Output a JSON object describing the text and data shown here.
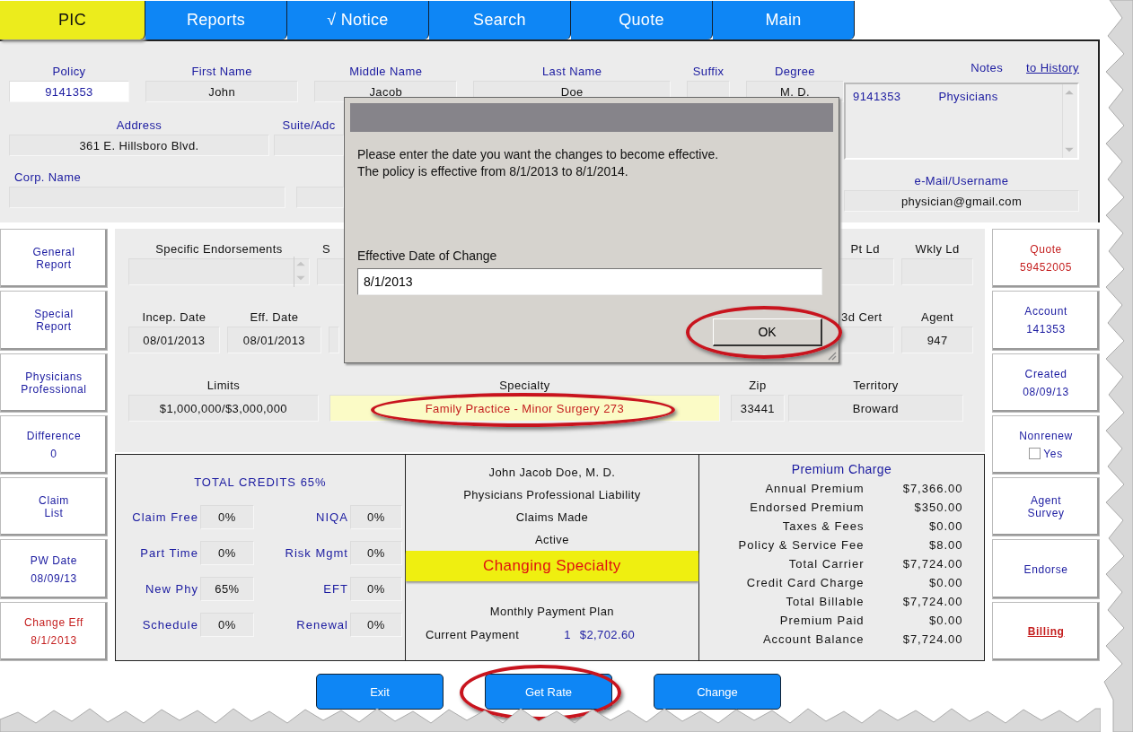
{
  "tabs": [
    {
      "label": "PIC",
      "selected": true
    },
    {
      "label": "Reports",
      "selected": false
    },
    {
      "label": "√ Notice",
      "selected": false
    },
    {
      "label": "Search",
      "selected": false
    },
    {
      "label": "Quote",
      "selected": false
    },
    {
      "label": "Main",
      "selected": false
    }
  ],
  "header": {
    "row1": [
      {
        "label": "Policy",
        "value": "9141353",
        "kind": "key"
      },
      {
        "label": "First Name",
        "value": "John",
        "kind": "plain"
      },
      {
        "label": "Middle Name",
        "value": "Jacob",
        "kind": "plain"
      },
      {
        "label": "Last Name",
        "value": "Doe",
        "kind": "plain"
      },
      {
        "label": "Suffix",
        "kind": "plain"
      },
      {
        "label": "Degree",
        "value": "M. D.",
        "kind": "plain"
      }
    ],
    "row2": [
      {
        "label": "Address",
        "value": "361 E. Hillsboro Blvd."
      },
      {
        "label": "Suite/Adc"
      }
    ],
    "corp": {
      "label": "Corp. Name"
    },
    "notes": {
      "label": "Notes",
      "link": "to History",
      "entries": [
        {
          "number": "9141353",
          "type": "Physicians"
        }
      ]
    },
    "email": {
      "label": "e-Mail/Username",
      "value": "physician@gmail.com"
    }
  },
  "dialog": {
    "message": [
      "Please enter the date you want the changes to become effective.",
      "The policy is effective from 8/1/2013 to 8/1/2014."
    ],
    "field_label": "Effective Date of Change",
    "field_value": "8/1/2013",
    "ok": {
      "label": "OK",
      "circled": true
    }
  },
  "left_buttons": [
    {
      "label": "General Report",
      "color": "#1a1aa0"
    },
    {
      "label": "Special Report",
      "color": "#1a1aa0"
    },
    {
      "label": "Physicians Professional",
      "color": "#1a1aa0"
    },
    {
      "label": "Difference",
      "value": "0",
      "color": "#1a1aa0"
    },
    {
      "label": "Claim List",
      "color": "#1a1aa0"
    },
    {
      "label": "PW Date",
      "value": "08/09/13",
      "color": "#1a1aa0"
    },
    {
      "label": "Change Eff",
      "value": "8/1/2013",
      "color": "#c41e1e"
    }
  ],
  "right_buttons": [
    {
      "kind": "button",
      "label": "Quote",
      "value": "59452005",
      "color": "#c41e1e"
    },
    {
      "kind": "button",
      "label": "Account",
      "value": "141353",
      "color": "#1a1aa0"
    },
    {
      "kind": "button",
      "label": "Created",
      "value": "08/09/13",
      "color": "#1a1aa0"
    },
    {
      "kind": "checkbox",
      "label": "Nonrenew",
      "option": "Yes",
      "checked": false,
      "color": "#1a1aa0"
    },
    {
      "kind": "button",
      "label": "Agent Survey",
      "color": "#1a1aa0"
    },
    {
      "kind": "button",
      "label": "Endorse",
      "color": "#1a1aa0"
    },
    {
      "kind": "link",
      "label": "Billing",
      "color": "#c41e1e"
    }
  ],
  "policy_panel": {
    "row1_left": [
      {
        "label": "Specific Endorsements",
        "kind": "spinner"
      },
      {
        "label": "S",
        "kind": "plain"
      }
    ],
    "row1_right": [
      {
        "label": "Pt Ld"
      },
      {
        "label": "Wkly Ld"
      }
    ],
    "row2_left": [
      {
        "label": "Incep. Date",
        "value": "08/01/2013"
      },
      {
        "label": "Eff. Date",
        "value": "08/01/2013"
      }
    ],
    "row2_right": [
      {
        "label": "3d Cert"
      },
      {
        "label": "Agent",
        "value": "947"
      }
    ],
    "row3": [
      {
        "label": "Limits",
        "value": "$1,000,000/$3,000,000",
        "kind": "plain"
      },
      {
        "label": "Specialty",
        "value": "Family Practice - Minor Surgery 273",
        "kind": "highlight",
        "circled": true
      },
      {
        "label": "Zip",
        "value": "33441",
        "kind": "plain"
      },
      {
        "label": "Territory",
        "value": "Broward",
        "kind": "plain"
      }
    ]
  },
  "credits": {
    "title": "TOTAL CREDITS 65%",
    "items": [
      {
        "label": "Claim Free",
        "value": "0%"
      },
      {
        "label": "NIQA",
        "value": "0%"
      },
      {
        "label": "Part Time",
        "value": "0%"
      },
      {
        "label": "Risk Mgmt",
        "value": "0%"
      },
      {
        "label": "New Phy",
        "value": "65%"
      },
      {
        "label": "EFT",
        "value": "0%"
      },
      {
        "label": "Schedule",
        "value": "0%"
      },
      {
        "label": "Renewal",
        "value": "0%"
      }
    ]
  },
  "summary": {
    "lines": [
      "John Jacob Doe, M. D.",
      "Physicians Professional Liability",
      "Claims Made",
      "Active"
    ],
    "status": "Changing Specialty",
    "plan": "Monthly Payment Plan",
    "payment": {
      "label": "Current Payment",
      "number": "1",
      "amount": "$2,702.60"
    }
  },
  "premium": {
    "title": "Premium Charge",
    "rows": [
      {
        "label": "Annual Premium",
        "value": "$7,366.00"
      },
      {
        "label": "Endorsed Premium",
        "value": "$350.00"
      },
      {
        "label": "Taxes & Fees",
        "value": "$0.00"
      },
      {
        "label": "Policy & Service Fee",
        "value": "$8.00"
      },
      {
        "label": "Total Carrier",
        "value": "$7,724.00"
      },
      {
        "label": "Credit Card Charge",
        "value": "$0.00"
      },
      {
        "label": "Total Billable",
        "value": "$7,724.00"
      },
      {
        "label": "Premium Paid",
        "value": "$0.00"
      },
      {
        "label": "Account Balance",
        "value": "$7,724.00"
      }
    ]
  },
  "actions": [
    {
      "label": "Exit",
      "circled": false
    },
    {
      "label": "Get Rate",
      "circled": true
    },
    {
      "label": "Change",
      "circled": false
    }
  ]
}
